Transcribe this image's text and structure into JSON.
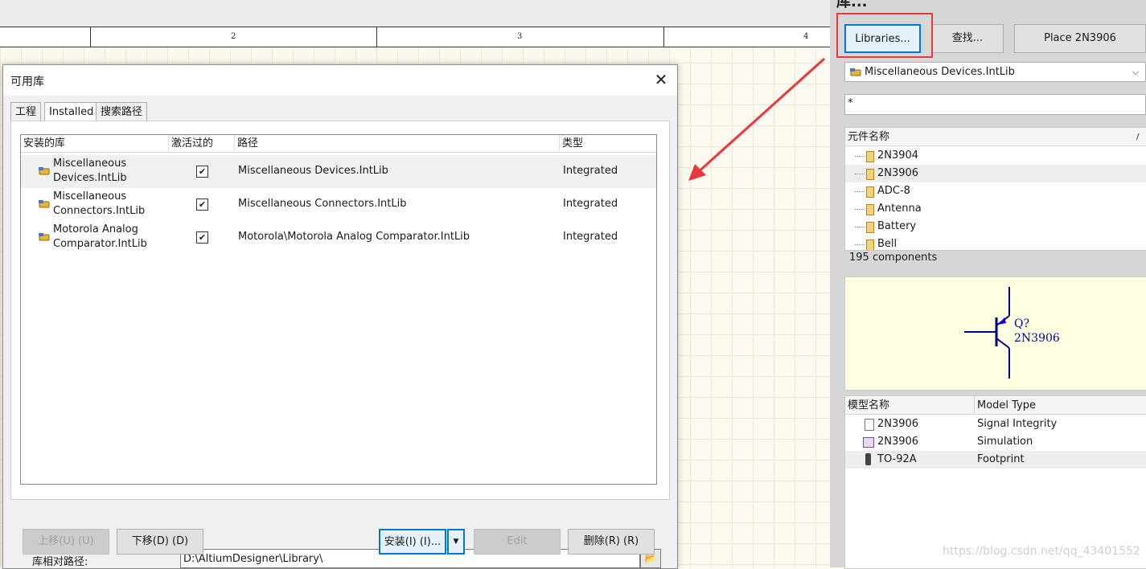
{
  "ruler": {
    "labels": [
      "2",
      "3",
      "4"
    ]
  },
  "dialog": {
    "title": "可用库",
    "tabs": [
      "工程",
      "Installed",
      "搜索路径"
    ],
    "columns": [
      "安装的库",
      "激活过的",
      "路径",
      "类型"
    ],
    "rows": [
      {
        "name_line1": "Miscellaneous",
        "name_line2": "Devices.IntLib",
        "active": "✔",
        "path": "Miscellaneous Devices.IntLib",
        "type": "Integrated"
      },
      {
        "name_line1": "Miscellaneous",
        "name_line2": "Connectors.IntLib",
        "active": "✔",
        "path": "Miscellaneous Connectors.IntLib",
        "type": "Integrated"
      },
      {
        "name_line1": "Motorola Analog",
        "name_line2": "Comparator.IntLib",
        "active": "✔",
        "path": "Motorola\\Motorola Analog Comparator.IntLib",
        "type": "Integrated"
      }
    ],
    "relative_path_label": "库相对路径:",
    "relative_path_value": "D:\\AltiumDesigner\\Library\\",
    "buttons": {
      "move_up": "上移(U) (U)",
      "move_down": "下移(D) (D)",
      "install": "安装(I) (I)...",
      "edit": "Edit",
      "remove": "删除(R) (R)"
    }
  },
  "panel": {
    "title": "库...",
    "libraries_button": "Libraries...",
    "search_button": "查找...",
    "place_button": "Place 2N3906",
    "selected_library": "Miscellaneous Devices.IntLib",
    "filter_value": "*",
    "component_header": "元件名称",
    "components": [
      "2N3904",
      "2N3906",
      "ADC-8",
      "Antenna",
      "Battery",
      "Bell"
    ],
    "component_count": "195 components",
    "preview": {
      "designator": "Q?",
      "part": "2N3906"
    },
    "model_headers": [
      "模型名称",
      "Model Type"
    ],
    "models": [
      {
        "name": "2N3906",
        "type": "Signal Integrity"
      },
      {
        "name": "2N3906",
        "type": "Simulation"
      },
      {
        "name": "TO-92A",
        "type": "Footprint"
      }
    ]
  },
  "watermark": "https://blog.csdn.net/qq_43401552",
  "colors": {
    "highlight": "#e8383d",
    "accent": "#0078d7",
    "arrow": "#e8383d"
  }
}
